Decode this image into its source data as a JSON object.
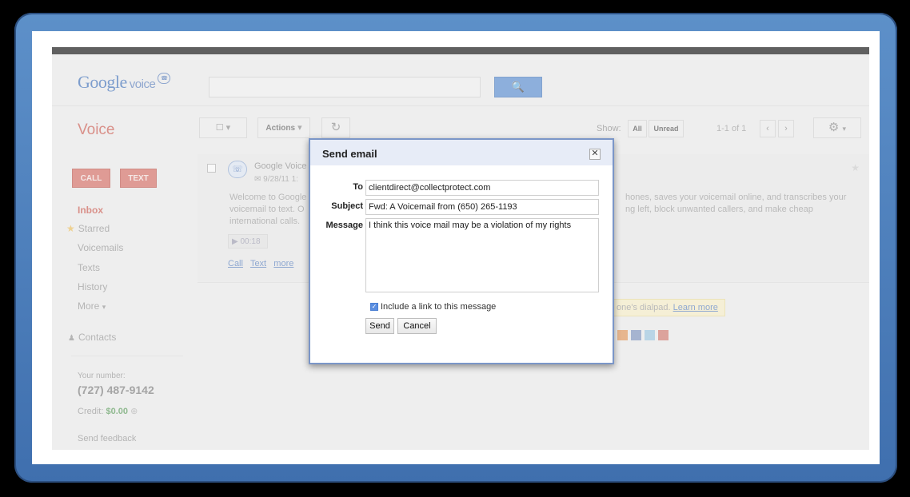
{
  "header": {
    "logo_google": "Google",
    "logo_voice": "voice"
  },
  "toolbar": {
    "page_title": "Voice",
    "actions_label": "Actions",
    "show_label": "Show:",
    "filter_all": "All",
    "filter_unread": "Unread",
    "pager_text": "1-1 of 1"
  },
  "sidebar": {
    "call_label": "CALL",
    "text_label": "TEXT",
    "nav": [
      "Inbox",
      "Starred",
      "Voicemails",
      "Texts",
      "History",
      "More"
    ],
    "contacts_label": "Contacts",
    "your_number_label": "Your number:",
    "your_number": "(727) 487-9142",
    "credit_label": "Credit:",
    "credit_value": "$0.00",
    "feedback_label": "Send feedback"
  },
  "message": {
    "sender": "Google Voice",
    "date": "9/28/11 1:",
    "body_line1_left": "Welcome to Google",
    "body_line2_left": "voicemail to text. O",
    "body_line3_left": "international calls.",
    "body_line1_right": "hones, saves your voicemail online, and transcribes your",
    "body_line2_right": "ng left, block unwanted callers, and make cheap",
    "duration": "00:18",
    "action_call": "Call",
    "action_text": "Text",
    "action_more": "more",
    "tip_text": "one's dialpad.",
    "tip_link": "Learn more"
  },
  "dialog": {
    "title": "Send email",
    "to_label": "To",
    "to_value": "clientdirect@collectprotect.com",
    "subject_label": "Subject",
    "subject_value": "Fwd: A Voicemail from (650) 265-1193",
    "message_label": "Message",
    "message_value": "I think this voice mail may be a violation of my rights",
    "include_link_label": "Include a link to this message",
    "include_link_checked": true,
    "send_label": "Send",
    "cancel_label": "Cancel"
  },
  "colors": {
    "accent_red": "#d56f66",
    "frame_blue": "#4f80bf",
    "search_blue": "#6b9ad8",
    "credit_green": "#3a9a3a"
  }
}
